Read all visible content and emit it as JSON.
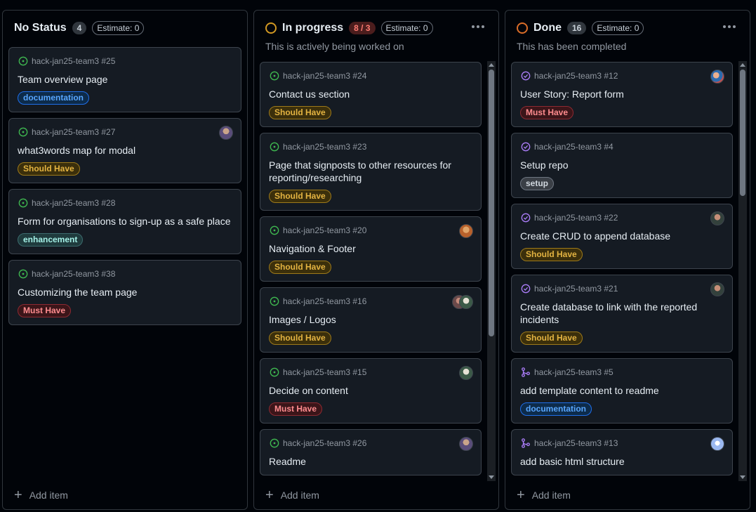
{
  "labels_colors": {
    "documentation": {
      "bg": "#0d2b4a",
      "fg": "#58a6ff",
      "border": "#1f6feb"
    },
    "should_have": {
      "bg": "#3b2f0b",
      "fg": "#e3b341",
      "border": "#9e7a1a"
    },
    "must_have": {
      "bg": "#3b1519",
      "fg": "#ff8c8f",
      "border": "#8e2a32"
    },
    "enhancement": {
      "bg": "#1f3b3d",
      "fg": "#a5f2e8",
      "border": "#3c6b6e"
    },
    "setup": {
      "bg": "#3a3f46",
      "fg": "#d0d7de",
      "border": "#6e7681"
    }
  },
  "columns": [
    {
      "title": "No Status",
      "count": "4",
      "estimate": "Estimate: 0",
      "description": "",
      "add_item": "Add item",
      "cards": [
        {
          "ref": "hack-jan25-team3 #25",
          "title": "Team overview page",
          "label": "documentation"
        },
        {
          "ref": "hack-jan25-team3 #27",
          "title": "what3words map for modal",
          "label": "Should Have"
        },
        {
          "ref": "hack-jan25-team3 #28",
          "title": "Form for organisations to sign-up as a safe place",
          "label": "enhancement"
        },
        {
          "ref": "hack-jan25-team3 #38",
          "title": "Customizing the team page",
          "label": "Must Have"
        }
      ]
    },
    {
      "title": "In progress",
      "count": "8 / 3",
      "estimate": "Estimate: 0",
      "description": "This is actively being worked on",
      "add_item": "Add item",
      "cards": [
        {
          "ref": "hack-jan25-team3 #24",
          "title": "Contact us section",
          "label": "Should Have"
        },
        {
          "ref": "hack-jan25-team3 #23",
          "title": "Page that signposts to other resources for reporting/researching",
          "label": "Should Have"
        },
        {
          "ref": "hack-jan25-team3 #20",
          "title": "Navigation & Footer",
          "label": "Should Have"
        },
        {
          "ref": "hack-jan25-team3 #16",
          "title": "Images / Logos",
          "label": "Should Have"
        },
        {
          "ref": "hack-jan25-team3 #15",
          "title": "Decide on content",
          "label": "Must Have"
        },
        {
          "ref": "hack-jan25-team3 #26",
          "title": "Readme",
          "label": ""
        }
      ]
    },
    {
      "title": "Done",
      "count": "16",
      "estimate": "Estimate: 0",
      "description": "This has been completed",
      "add_item": "Add item",
      "cards": [
        {
          "ref": "hack-jan25-team3 #12",
          "title": "User Story: Report form",
          "label": "Must Have"
        },
        {
          "ref": "hack-jan25-team3 #4",
          "title": "Setup repo",
          "label": "setup"
        },
        {
          "ref": "hack-jan25-team3 #22",
          "title": "Create CRUD to append database",
          "label": "Should Have"
        },
        {
          "ref": "hack-jan25-team3 #21",
          "title": "Create database to link with the reported incidents",
          "label": "Should Have"
        },
        {
          "ref": "hack-jan25-team3 #5",
          "title": "add template content to readme",
          "label": "documentation"
        },
        {
          "ref": "hack-jan25-team3 #13",
          "title": "add basic html structure",
          "label": ""
        }
      ]
    }
  ]
}
